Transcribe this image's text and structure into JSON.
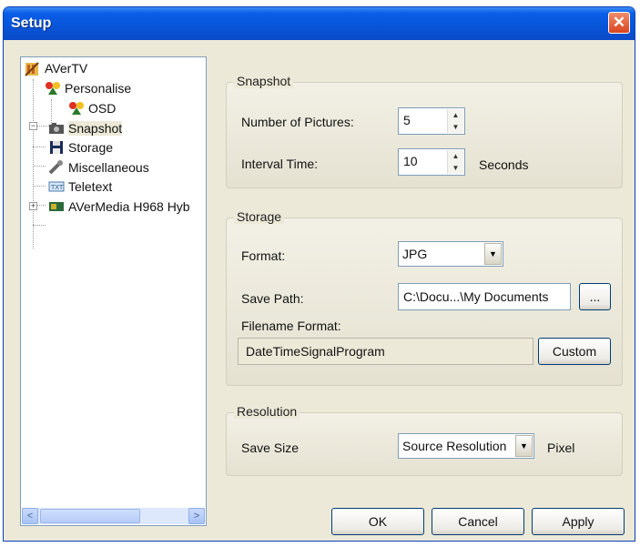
{
  "window": {
    "title": "Setup",
    "close_glyph": "✕"
  },
  "tree": {
    "items": [
      {
        "label": "AVerTV",
        "icon": "avertv-icon"
      },
      {
        "label": "Personalise",
        "icon": "personalise-icon"
      },
      {
        "label": "OSD",
        "icon": "osd-icon"
      },
      {
        "label": "Snapshot",
        "icon": "camera-icon"
      },
      {
        "label": "Storage",
        "icon": "floppy-disk-icon"
      },
      {
        "label": "Miscellaneous",
        "icon": "wrench-icon"
      },
      {
        "label": "Teletext",
        "icon": "teletext-icon"
      },
      {
        "label": "AVerMedia H968 Hyb",
        "icon": "tv-card-icon"
      }
    ],
    "selected": "Snapshot",
    "scroll_left": "<",
    "scroll_right": ">"
  },
  "snapshot": {
    "legend": "Snapshot",
    "number_label": "Number of Pictures:",
    "number_value": "5",
    "interval_label": "Interval Time:",
    "interval_value": "10",
    "interval_unit": "Seconds"
  },
  "storage": {
    "legend": "Storage",
    "format_label": "Format:",
    "format_value": "JPG",
    "save_path_label": "Save Path:",
    "save_path_value": "C:\\Docu...\\My Documents",
    "browse_label": "...",
    "filename_format_label": "Filename Format:",
    "filename_format_value": "DateTimeSignalProgram",
    "custom_label": "Custom"
  },
  "resolution": {
    "legend": "Resolution",
    "save_size_label": "Save Size",
    "save_size_value": "Source Resolution",
    "unit": "Pixel"
  },
  "footer": {
    "ok": "OK",
    "cancel": "Cancel",
    "apply": "Apply"
  }
}
